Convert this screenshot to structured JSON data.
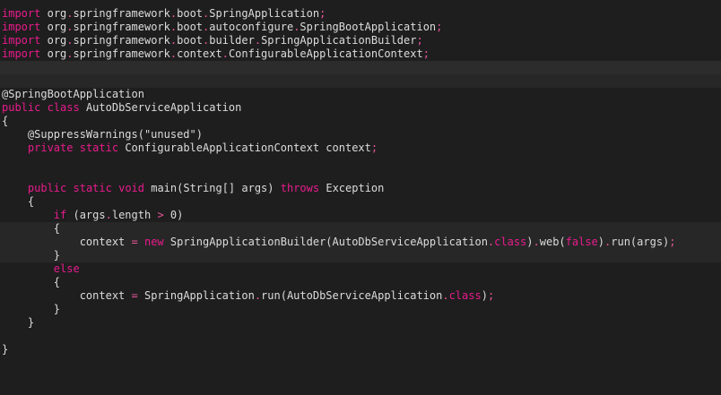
{
  "colors": {
    "background": "#1e1e1e",
    "keyword": "#e81b8c",
    "identifier": "#dcdcdc",
    "punctuation": "#e8549a"
  },
  "lines": [
    [
      [
        "kw",
        "import"
      ],
      [
        "pl",
        " "
      ],
      [
        "id",
        "org"
      ],
      [
        "pu",
        "."
      ],
      [
        "id",
        "springframework"
      ],
      [
        "pu",
        "."
      ],
      [
        "id",
        "boot"
      ],
      [
        "pu",
        "."
      ],
      [
        "id",
        "SpringApplication"
      ],
      [
        "pu",
        ";"
      ]
    ],
    [
      [
        "kw",
        "import"
      ],
      [
        "pl",
        " "
      ],
      [
        "id",
        "org"
      ],
      [
        "pu",
        "."
      ],
      [
        "id",
        "springframework"
      ],
      [
        "pu",
        "."
      ],
      [
        "id",
        "boot"
      ],
      [
        "pu",
        "."
      ],
      [
        "id",
        "autoconfigure"
      ],
      [
        "pu",
        "."
      ],
      [
        "id",
        "SpringBootApplication"
      ],
      [
        "pu",
        ";"
      ]
    ],
    [
      [
        "kw",
        "import"
      ],
      [
        "pl",
        " "
      ],
      [
        "id",
        "org"
      ],
      [
        "pu",
        "."
      ],
      [
        "id",
        "springframework"
      ],
      [
        "pu",
        "."
      ],
      [
        "id",
        "boot"
      ],
      [
        "pu",
        "."
      ],
      [
        "id",
        "builder"
      ],
      [
        "pu",
        "."
      ],
      [
        "id",
        "SpringApplicationBuilder"
      ],
      [
        "pu",
        ";"
      ]
    ],
    [
      [
        "kw",
        "import"
      ],
      [
        "pl",
        " "
      ],
      [
        "id",
        "org"
      ],
      [
        "pu",
        "."
      ],
      [
        "id",
        "springframework"
      ],
      [
        "pu",
        "."
      ],
      [
        "id",
        "context"
      ],
      [
        "pu",
        "."
      ],
      [
        "id",
        "ConfigurableApplicationContext"
      ],
      [
        "pu",
        ";"
      ]
    ],
    [],
    [],
    [
      [
        "id",
        "@SpringBootApplication"
      ]
    ],
    [
      [
        "kw",
        "public"
      ],
      [
        "pl",
        " "
      ],
      [
        "kw",
        "class"
      ],
      [
        "pl",
        " "
      ],
      [
        "id",
        "AutoDbServiceApplication"
      ]
    ],
    [
      [
        "pl",
        "{"
      ]
    ],
    [
      [
        "pl",
        "    "
      ],
      [
        "id",
        "@SuppressWarnings(\"unused\")"
      ]
    ],
    [
      [
        "pl",
        "    "
      ],
      [
        "kw",
        "private"
      ],
      [
        "pl",
        " "
      ],
      [
        "kw",
        "static"
      ],
      [
        "pl",
        " "
      ],
      [
        "id",
        "ConfigurableApplicationContext"
      ],
      [
        "pl",
        " "
      ],
      [
        "id",
        "context"
      ],
      [
        "pu",
        ";"
      ]
    ],
    [],
    [],
    [
      [
        "pl",
        "    "
      ],
      [
        "kw",
        "public"
      ],
      [
        "pl",
        " "
      ],
      [
        "kw",
        "static"
      ],
      [
        "pl",
        " "
      ],
      [
        "kw",
        "void"
      ],
      [
        "pl",
        " "
      ],
      [
        "id",
        "main(String[] args)"
      ],
      [
        "pl",
        " "
      ],
      [
        "kw",
        "throws"
      ],
      [
        "pl",
        " "
      ],
      [
        "id",
        "Exception"
      ]
    ],
    [
      [
        "pl",
        "    {"
      ]
    ],
    [
      [
        "pl",
        "        "
      ],
      [
        "kw",
        "if"
      ],
      [
        "pl",
        " "
      ],
      [
        "id",
        "(args"
      ],
      [
        "pu",
        "."
      ],
      [
        "id",
        "length"
      ],
      [
        "pl",
        " "
      ],
      [
        "pu",
        ">"
      ],
      [
        "pl",
        " "
      ],
      [
        "id",
        "0)"
      ]
    ],
    [
      [
        "pl",
        "        {"
      ]
    ],
    [
      [
        "pl",
        "            "
      ],
      [
        "id",
        "context"
      ],
      [
        "pl",
        " "
      ],
      [
        "pu",
        "="
      ],
      [
        "pl",
        " "
      ],
      [
        "kw",
        "new"
      ],
      [
        "pl",
        " "
      ],
      [
        "id",
        "SpringApplicationBuilder(AutoDbServiceApplication"
      ],
      [
        "pu",
        "."
      ],
      [
        "kw",
        "class"
      ],
      [
        "id",
        ")"
      ],
      [
        "pu",
        "."
      ],
      [
        "id",
        "web("
      ],
      [
        "kw",
        "false"
      ],
      [
        "id",
        ")"
      ],
      [
        "pu",
        "."
      ],
      [
        "id",
        "run(args)"
      ],
      [
        "pu",
        ";"
      ]
    ],
    [
      [
        "pl",
        "        }"
      ]
    ],
    [
      [
        "pl",
        "        "
      ],
      [
        "kw",
        "else"
      ]
    ],
    [
      [
        "pl",
        "        {"
      ]
    ],
    [
      [
        "pl",
        "            "
      ],
      [
        "id",
        "context"
      ],
      [
        "pl",
        " "
      ],
      [
        "pu",
        "="
      ],
      [
        "pl",
        " "
      ],
      [
        "id",
        "SpringApplication"
      ],
      [
        "pu",
        "."
      ],
      [
        "id",
        "run(AutoDbServiceApplication"
      ],
      [
        "pu",
        "."
      ],
      [
        "kw",
        "class"
      ],
      [
        "id",
        ")"
      ],
      [
        "pu",
        ";"
      ]
    ],
    [
      [
        "pl",
        "        }"
      ]
    ],
    [
      [
        "pl",
        "    }"
      ]
    ],
    [],
    [
      [
        "pl",
        "}"
      ]
    ]
  ]
}
